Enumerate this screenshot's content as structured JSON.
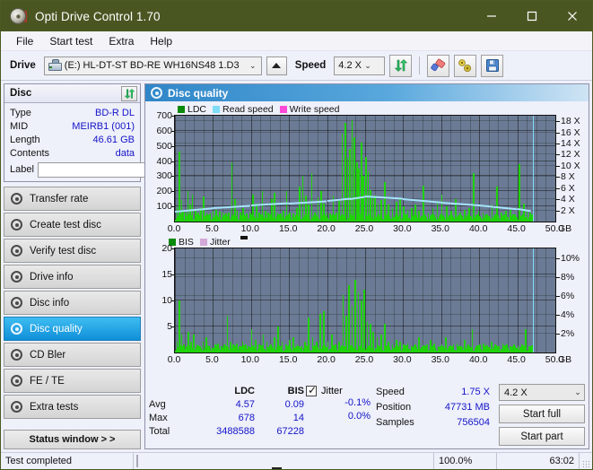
{
  "window": {
    "title": "Opti Drive Control 1.70",
    "icon": "disc-icon",
    "minimize": "minimize-icon",
    "maximize": "maximize-icon",
    "close": "close-icon"
  },
  "menu": {
    "items": [
      "File",
      "Start test",
      "Extra",
      "Help"
    ]
  },
  "toolbar": {
    "drive_label": "Drive",
    "drive_value": "(E:)  HL-DT-ST BD-RE  WH16NS48 1.D3",
    "eject_icon": "eject-icon",
    "speed_label": "Speed",
    "speed_value": "4.2 X",
    "refresh_icon": "refresh-icon",
    "eraser_icon": "eraser-icon",
    "tools_icon": "tools-icon",
    "save_icon": "save-icon"
  },
  "sidebar": {
    "disc_panel": {
      "title": "Disc",
      "refresh_icon": "refresh-icon",
      "rows": [
        {
          "key": "Type",
          "value": "BD-R DL"
        },
        {
          "key": "MID",
          "value": "MEIRB1 (001)"
        },
        {
          "key": "Length",
          "value": "46.61 GB"
        },
        {
          "key": "Contents",
          "value": "data"
        }
      ],
      "label_key": "Label",
      "label_value": "",
      "label_placeholder": "",
      "disc_icon": "disc-icon"
    },
    "nav": [
      {
        "label": "Transfer rate",
        "icon": "disc-icon",
        "active": false
      },
      {
        "label": "Create test disc",
        "icon": "disc-icon",
        "active": false
      },
      {
        "label": "Verify test disc",
        "icon": "disc-icon",
        "active": false
      },
      {
        "label": "Drive info",
        "icon": "disc-icon",
        "active": false
      },
      {
        "label": "Disc info",
        "icon": "disc-icon",
        "active": false
      },
      {
        "label": "Disc quality",
        "icon": "disc-icon",
        "active": true
      },
      {
        "label": "CD Bler",
        "icon": "disc-icon",
        "active": false
      },
      {
        "label": "FE / TE",
        "icon": "disc-icon",
        "active": false
      },
      {
        "label": "Extra tests",
        "icon": "disc-icon",
        "active": false
      }
    ],
    "status_button": "Status window > >"
  },
  "main": {
    "header_title": "Disc quality",
    "header_icon": "disc-icon"
  },
  "stats": {
    "columns": [
      "LDC",
      "BIS"
    ],
    "rows": [
      {
        "label": "Avg",
        "ldc": "4.57",
        "bis": "0.09"
      },
      {
        "label": "Max",
        "ldc": "678",
        "bis": "14"
      },
      {
        "label": "Total",
        "ldc": "3488588",
        "bis": "67228"
      }
    ],
    "jitter_label": "Jitter",
    "jitter_checked": true,
    "jitter_values": [
      "-0.1%",
      "0.0%"
    ],
    "speed_label": "Speed",
    "speed_value": "1.75 X",
    "position_label": "Position",
    "position_value": "47731 MB",
    "samples_label": "Samples",
    "samples_value": "756504",
    "speed_select": "4.2 X",
    "start_full": "Start full",
    "start_part": "Start part"
  },
  "statusbar": {
    "message": "Test completed",
    "percent": "100.0%",
    "progress": 100,
    "time": "63:02"
  },
  "colors": {
    "titlebar": "#4a5622",
    "ldc_green": "#1fd20a",
    "read_speed": "#7fdcf7",
    "write_speed": "#ff4ad8",
    "jitter": "#d4a8d8",
    "plot_bg": "#6b7b95",
    "accent_blue": "#0f8fd8",
    "value_blue": "#1414c8",
    "progress_green": "#18a018"
  },
  "chart_data": [
    {
      "type": "bar",
      "title": "Disc quality - LDC",
      "xlabel": "GB",
      "ylabel": "LDC",
      "xlim": [
        0,
        50
      ],
      "ylim": [
        0,
        700
      ],
      "xticks": [
        "0.0",
        "5.0",
        "10.0",
        "15.0",
        "20.0",
        "25.0",
        "30.0",
        "35.0",
        "40.0",
        "45.0",
        "50.0"
      ],
      "yticks": [
        100,
        200,
        300,
        400,
        500,
        600,
        700
      ],
      "y2ticks": [
        "2 X",
        "4 X",
        "6 X",
        "8 X",
        "10 X",
        "12 X",
        "14 X",
        "16 X",
        "18 X"
      ],
      "y2lim": [
        0,
        19
      ],
      "legend": [
        {
          "name": "LDC",
          "color": "#0a8a0a"
        },
        {
          "name": "Read speed",
          "color": "#7fdcf7"
        },
        {
          "name": "Write speed",
          "color": "#ff4ad8"
        }
      ],
      "legend_position": "top-left",
      "grid": true,
      "cursor_x": 47.0,
      "series": [
        {
          "name": "LDC",
          "type": "bar",
          "color": "#1fd20a",
          "x": [
            0.2,
            0.5,
            0.8,
            1.0,
            1.3,
            1.6,
            1.9,
            2.2,
            2.6,
            3.0,
            3.3,
            3.7,
            4.1,
            4.5,
            4.9,
            5.3,
            5.8,
            6.2,
            6.6,
            7.0,
            7.4,
            7.8,
            8.1,
            8.5,
            8.9,
            9.3,
            9.8,
            10.2,
            10.6,
            11.0,
            11.4,
            11.8,
            12.2,
            12.6,
            13.0,
            13.4,
            13.8,
            14.2,
            14.6,
            15.0,
            15.5,
            15.9,
            16.3,
            16.7,
            17.1,
            17.5,
            17.9,
            18.3,
            18.7,
            19.1,
            19.5,
            19.9,
            20.3,
            20.7,
            21.1,
            21.5,
            21.9,
            22.3,
            22.6,
            22.9,
            23.2,
            23.5,
            23.8,
            24.1,
            24.4,
            24.7,
            25.0,
            25.3,
            25.6,
            25.9,
            26.2,
            26.6,
            27.0,
            27.5,
            28.0,
            28.5,
            29.0,
            29.5,
            30.0,
            30.5,
            31.0,
            31.5,
            32.0,
            32.6,
            33.2,
            33.8,
            34.4,
            35.0,
            35.6,
            36.2,
            36.8,
            37.4,
            38.0,
            38.6,
            39.2,
            39.8,
            40.4,
            41.0,
            41.6,
            42.2,
            42.8,
            43.4,
            44.0,
            44.6,
            45.2,
            45.8,
            46.2,
            46.6
          ],
          "values": [
            95,
            460,
            140,
            70,
            60,
            200,
            110,
            180,
            70,
            60,
            90,
            165,
            60,
            55,
            70,
            80,
            65,
            60,
            55,
            60,
            390,
            150,
            70,
            60,
            90,
            55,
            60,
            180,
            120,
            60,
            200,
            70,
            60,
            150,
            190,
            60,
            55,
            70,
            200,
            60,
            55,
            90,
            230,
            300,
            170,
            110,
            320,
            60,
            160,
            200,
            120,
            60,
            55,
            175,
            60,
            150,
            580,
            650,
            420,
            480,
            670,
            560,
            390,
            350,
            520,
            300,
            430,
            330,
            210,
            160,
            170,
            120,
            140,
            260,
            110,
            90,
            130,
            150,
            100,
            80,
            90,
            110,
            70,
            240,
            60,
            90,
            130,
            180,
            100,
            70,
            150,
            60,
            80,
            90,
            320,
            70,
            60,
            50,
            110,
            230,
            60,
            70,
            80,
            50,
            380,
            120,
            70,
            60
          ]
        },
        {
          "name": "Read speed",
          "type": "line",
          "color": "#a5e4fb",
          "x": [
            0.0,
            5.0,
            10.0,
            15.0,
            20.0,
            23.0,
            25.0,
            30.0,
            35.0,
            40.0,
            45.0,
            46.8
          ],
          "values_x_axis": [
            2.0,
            2.6,
            3.0,
            3.4,
            3.8,
            4.2,
            4.6,
            4.2,
            3.6,
            3.1,
            2.4,
            2.0
          ]
        }
      ]
    },
    {
      "type": "bar",
      "title": "Disc quality - BIS",
      "xlabel": "GB",
      "ylabel": "BIS",
      "xlim": [
        0,
        50
      ],
      "ylim": [
        0,
        20
      ],
      "xticks": [
        "0.0",
        "5.0",
        "10.0",
        "15.0",
        "20.0",
        "25.0",
        "30.0",
        "35.0",
        "40.0",
        "45.0",
        "50.0"
      ],
      "yticks": [
        5,
        10,
        15,
        20
      ],
      "y2ticks": [
        "2%",
        "4%",
        "6%",
        "8%",
        "10%"
      ],
      "y2lim": [
        0,
        11
      ],
      "legend": [
        {
          "name": "BIS",
          "color": "#0a8a0a"
        },
        {
          "name": "Jitter",
          "color": "#d4a8d8"
        }
      ],
      "legend_position": "top-left",
      "grid": true,
      "cursor_x": 47.0,
      "series": [
        {
          "name": "BIS",
          "type": "bar",
          "color": "#1fd20a",
          "x": [
            0.2,
            0.5,
            0.8,
            1.1,
            1.4,
            1.7,
            2.0,
            2.4,
            2.8,
            3.2,
            3.6,
            4.0,
            4.4,
            4.8,
            5.2,
            5.6,
            6.0,
            6.4,
            6.8,
            7.2,
            7.6,
            8.0,
            8.4,
            8.8,
            9.2,
            9.6,
            10.0,
            10.5,
            11.0,
            11.5,
            12.0,
            12.5,
            13.0,
            13.5,
            14.0,
            14.5,
            15.0,
            15.5,
            16.0,
            16.5,
            17.0,
            17.5,
            18.0,
            18.5,
            19.0,
            19.5,
            20.0,
            20.5,
            21.0,
            21.5,
            22.0,
            22.4,
            22.8,
            23.2,
            23.6,
            24.0,
            24.4,
            24.8,
            25.2,
            25.6,
            26.0,
            26.5,
            27.0,
            27.5,
            28.0,
            28.5,
            29.0,
            29.5,
            30.0,
            30.5,
            31.0,
            31.5,
            32.0,
            32.5,
            33.0,
            33.5,
            34.0,
            34.5,
            35.0,
            35.5,
            36.0,
            36.5,
            37.0,
            37.5,
            38.0,
            38.5,
            39.0,
            39.5,
            40.0,
            40.5,
            41.0,
            41.5,
            42.0,
            42.5,
            43.0,
            43.5,
            44.0,
            44.5,
            45.0,
            45.5,
            46.0,
            46.5
          ],
          "values": [
            2.0,
            10.0,
            3.5,
            1.5,
            1.2,
            4.0,
            2.0,
            3.5,
            1.5,
            1.2,
            2.0,
            3.0,
            1.2,
            1.0,
            1.5,
            1.8,
            1.2,
            1.5,
            7.0,
            2.0,
            1.5,
            1.8,
            1.2,
            2.0,
            1.5,
            1.2,
            4.5,
            2.5,
            1.5,
            3.5,
            2.0,
            1.5,
            3.0,
            5.0,
            2.0,
            1.5,
            2.5,
            3.0,
            1.5,
            1.2,
            2.0,
            6.8,
            3.0,
            2.0,
            7.5,
            8.0,
            2.0,
            3.5,
            1.5,
            2.0,
            11.0,
            7.0,
            13.0,
            9.0,
            14.0,
            11.5,
            10.0,
            12.0,
            6.0,
            5.5,
            4.0,
            3.0,
            3.5,
            5.5,
            2.0,
            1.5,
            2.5,
            2.0,
            1.5,
            1.8,
            1.2,
            1.5,
            3.0,
            1.2,
            1.5,
            2.5,
            1.8,
            1.2,
            1.5,
            3.0,
            1.2,
            1.5,
            1.8,
            1.2,
            2.5,
            1.5,
            4.5,
            1.2,
            1.5,
            1.8,
            1.2,
            2.0,
            1.5,
            1.2,
            1.8,
            1.5,
            1.2,
            1.5,
            1.2,
            1.5,
            4.5,
            1.2
          ]
        }
      ]
    }
  ]
}
